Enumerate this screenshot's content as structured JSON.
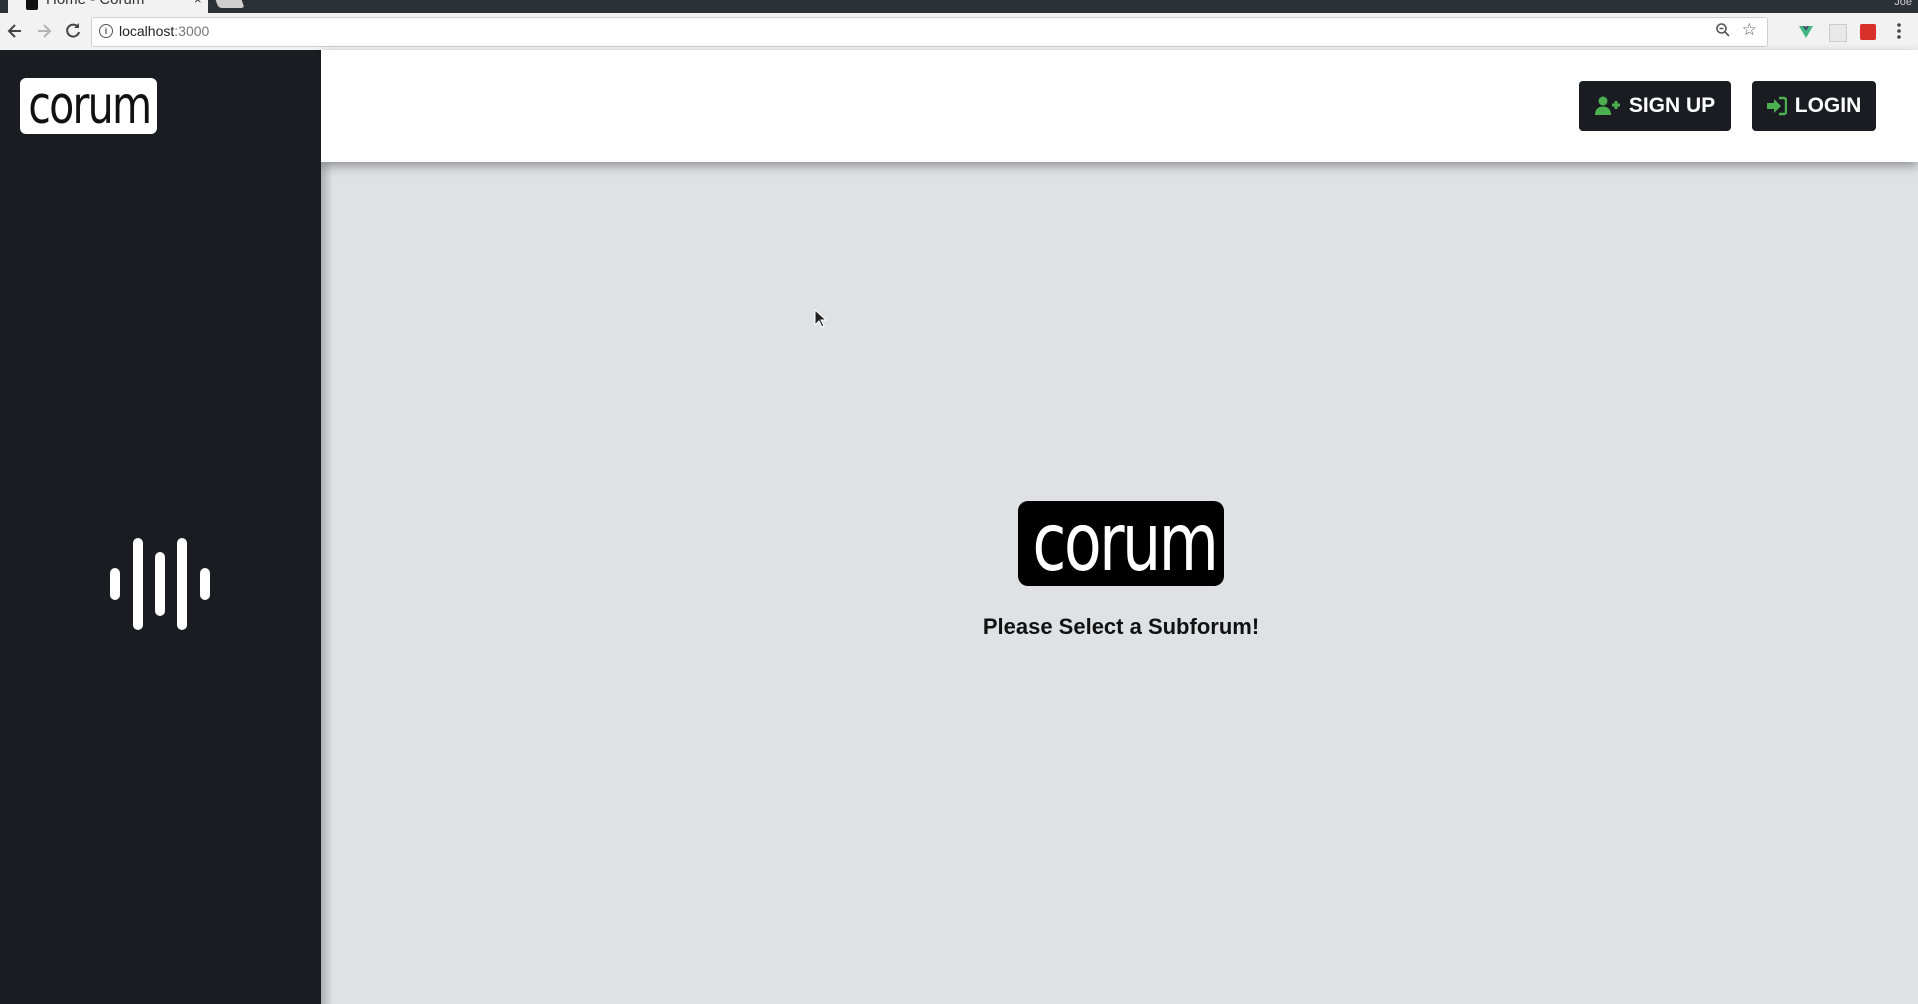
{
  "browser": {
    "tab_title": "Home - Corum",
    "tab_close": "×",
    "profile_name": "Joe",
    "url_host": "localhost",
    "url_port": ":3000"
  },
  "sidebar": {
    "logo_text": "corum",
    "audio_icon": "audio-bars-icon"
  },
  "header": {
    "signup_label": "SIGN UP",
    "login_label": "LOGIN",
    "icon_accent": "#4caf50"
  },
  "main": {
    "logo_text": "corum",
    "prompt": "Please Select a Subforum!"
  },
  "colors": {
    "sidebar_bg": "#1a1c21",
    "main_bg": "#e0e1e5",
    "header_bg": "#ffffff",
    "button_bg": "#1a1c21"
  }
}
